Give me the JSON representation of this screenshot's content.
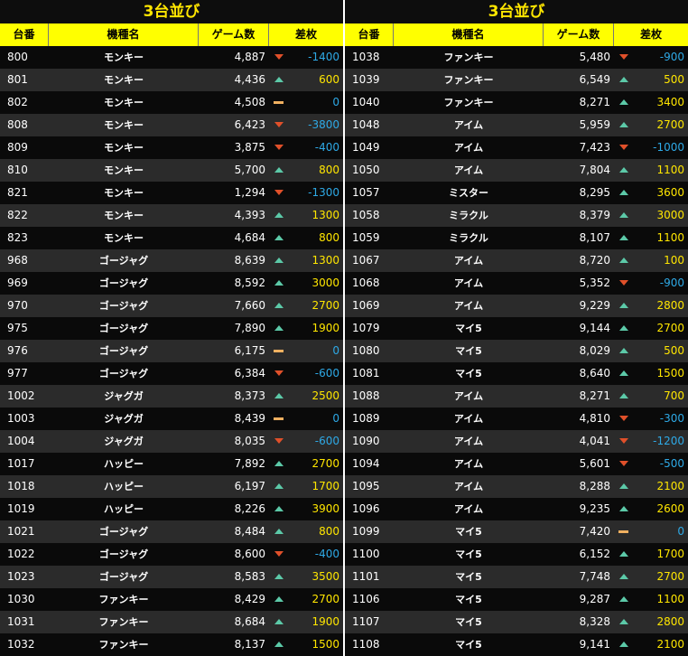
{
  "colors": {
    "title": "#ffe600",
    "header_bg": "#ffff00",
    "positive": "#ffe600",
    "negative": "#2ea9e6",
    "up_icon": "#5cc9a8",
    "down_icon": "#e0502a",
    "flat_icon": "#f0b060"
  },
  "headers": {
    "no": "台番",
    "name": "機種名",
    "games": "ゲーム数",
    "diff": "差枚"
  },
  "panels": [
    {
      "title": "3台並び",
      "rows": [
        {
          "no": "800",
          "name": "モンキー",
          "games": "4,887",
          "trend": "down",
          "diff": "-1400"
        },
        {
          "no": "801",
          "name": "モンキー",
          "games": "4,436",
          "trend": "up",
          "diff": "600"
        },
        {
          "no": "802",
          "name": "モンキー",
          "games": "4,508",
          "trend": "flat",
          "diff": "0"
        },
        {
          "no": "808",
          "name": "モンキー",
          "games": "6,423",
          "trend": "down",
          "diff": "-3800"
        },
        {
          "no": "809",
          "name": "モンキー",
          "games": "3,875",
          "trend": "down",
          "diff": "-400"
        },
        {
          "no": "810",
          "name": "モンキー",
          "games": "5,700",
          "trend": "up",
          "diff": "800"
        },
        {
          "no": "821",
          "name": "モンキー",
          "games": "1,294",
          "trend": "down",
          "diff": "-1300"
        },
        {
          "no": "822",
          "name": "モンキー",
          "games": "4,393",
          "trend": "up",
          "diff": "1300"
        },
        {
          "no": "823",
          "name": "モンキー",
          "games": "4,684",
          "trend": "up",
          "diff": "800"
        },
        {
          "no": "968",
          "name": "ゴージャグ",
          "games": "8,639",
          "trend": "up",
          "diff": "1300"
        },
        {
          "no": "969",
          "name": "ゴージャグ",
          "games": "8,592",
          "trend": "up",
          "diff": "3000"
        },
        {
          "no": "970",
          "name": "ゴージャグ",
          "games": "7,660",
          "trend": "up",
          "diff": "2700"
        },
        {
          "no": "975",
          "name": "ゴージャグ",
          "games": "7,890",
          "trend": "up",
          "diff": "1900"
        },
        {
          "no": "976",
          "name": "ゴージャグ",
          "games": "6,175",
          "trend": "flat",
          "diff": "0"
        },
        {
          "no": "977",
          "name": "ゴージャグ",
          "games": "6,384",
          "trend": "down",
          "diff": "-600"
        },
        {
          "no": "1002",
          "name": "ジャグガ",
          "games": "8,373",
          "trend": "up",
          "diff": "2500"
        },
        {
          "no": "1003",
          "name": "ジャグガ",
          "games": "8,439",
          "trend": "flat",
          "diff": "0"
        },
        {
          "no": "1004",
          "name": "ジャグガ",
          "games": "8,035",
          "trend": "down",
          "diff": "-600"
        },
        {
          "no": "1017",
          "name": "ハッピー",
          "games": "7,892",
          "trend": "up",
          "diff": "2700"
        },
        {
          "no": "1018",
          "name": "ハッピー",
          "games": "6,197",
          "trend": "up",
          "diff": "1700"
        },
        {
          "no": "1019",
          "name": "ハッピー",
          "games": "8,226",
          "trend": "up",
          "diff": "3900"
        },
        {
          "no": "1021",
          "name": "ゴージャグ",
          "games": "8,484",
          "trend": "up",
          "diff": "800"
        },
        {
          "no": "1022",
          "name": "ゴージャグ",
          "games": "8,600",
          "trend": "down",
          "diff": "-400"
        },
        {
          "no": "1023",
          "name": "ゴージャグ",
          "games": "8,583",
          "trend": "up",
          "diff": "3500"
        },
        {
          "no": "1030",
          "name": "ファンキー",
          "games": "8,429",
          "trend": "up",
          "diff": "2700"
        },
        {
          "no": "1031",
          "name": "ファンキー",
          "games": "8,684",
          "trend": "up",
          "diff": "1900"
        },
        {
          "no": "1032",
          "name": "ファンキー",
          "games": "8,137",
          "trend": "up",
          "diff": "1500"
        }
      ]
    },
    {
      "title": "3台並び",
      "rows": [
        {
          "no": "1038",
          "name": "ファンキー",
          "games": "5,480",
          "trend": "down",
          "diff": "-900"
        },
        {
          "no": "1039",
          "name": "ファンキー",
          "games": "6,549",
          "trend": "up",
          "diff": "500"
        },
        {
          "no": "1040",
          "name": "ファンキー",
          "games": "8,271",
          "trend": "up",
          "diff": "3400"
        },
        {
          "no": "1048",
          "name": "アイム",
          "games": "5,959",
          "trend": "up",
          "diff": "2700"
        },
        {
          "no": "1049",
          "name": "アイム",
          "games": "7,423",
          "trend": "down",
          "diff": "-1000"
        },
        {
          "no": "1050",
          "name": "アイム",
          "games": "7,804",
          "trend": "up",
          "diff": "1100"
        },
        {
          "no": "1057",
          "name": "ミスター",
          "games": "8,295",
          "trend": "up",
          "diff": "3600"
        },
        {
          "no": "1058",
          "name": "ミラクル",
          "games": "8,379",
          "trend": "up",
          "diff": "3000"
        },
        {
          "no": "1059",
          "name": "ミラクル",
          "games": "8,107",
          "trend": "up",
          "diff": "1100"
        },
        {
          "no": "1067",
          "name": "アイム",
          "games": "8,720",
          "trend": "up",
          "diff": "100"
        },
        {
          "no": "1068",
          "name": "アイム",
          "games": "5,352",
          "trend": "down",
          "diff": "-900"
        },
        {
          "no": "1069",
          "name": "アイム",
          "games": "9,229",
          "trend": "up",
          "diff": "2800"
        },
        {
          "no": "1079",
          "name": "マイ5",
          "games": "9,144",
          "trend": "up",
          "diff": "2700"
        },
        {
          "no": "1080",
          "name": "マイ5",
          "games": "8,029",
          "trend": "up",
          "diff": "500"
        },
        {
          "no": "1081",
          "name": "マイ5",
          "games": "8,640",
          "trend": "up",
          "diff": "1500"
        },
        {
          "no": "1088",
          "name": "アイム",
          "games": "8,271",
          "trend": "up",
          "diff": "700"
        },
        {
          "no": "1089",
          "name": "アイム",
          "games": "4,810",
          "trend": "down",
          "diff": "-300"
        },
        {
          "no": "1090",
          "name": "アイム",
          "games": "4,041",
          "trend": "down",
          "diff": "-1200"
        },
        {
          "no": "1094",
          "name": "アイム",
          "games": "5,601",
          "trend": "down",
          "diff": "-500"
        },
        {
          "no": "1095",
          "name": "アイム",
          "games": "8,288",
          "trend": "up",
          "diff": "2100"
        },
        {
          "no": "1096",
          "name": "アイム",
          "games": "9,235",
          "trend": "up",
          "diff": "2600"
        },
        {
          "no": "1099",
          "name": "マイ5",
          "games": "7,420",
          "trend": "flat",
          "diff": "0"
        },
        {
          "no": "1100",
          "name": "マイ5",
          "games": "6,152",
          "trend": "up",
          "diff": "1700"
        },
        {
          "no": "1101",
          "name": "マイ5",
          "games": "7,748",
          "trend": "up",
          "diff": "2700"
        },
        {
          "no": "1106",
          "name": "マイ5",
          "games": "9,287",
          "trend": "up",
          "diff": "1100"
        },
        {
          "no": "1107",
          "name": "マイ5",
          "games": "8,328",
          "trend": "up",
          "diff": "2800"
        },
        {
          "no": "1108",
          "name": "マイ5",
          "games": "9,141",
          "trend": "up",
          "diff": "2100"
        }
      ]
    }
  ]
}
